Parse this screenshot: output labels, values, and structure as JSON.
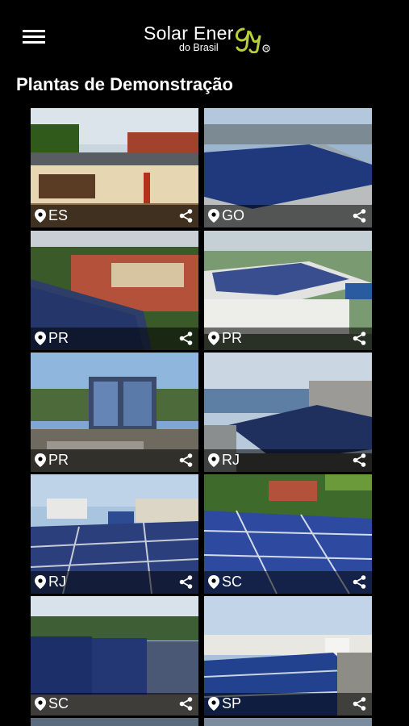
{
  "header": {
    "logo_text_main": "Solar Ener",
    "logo_text_sub": "do Brasil",
    "menu_icon": "hamburger-menu-icon"
  },
  "page": {
    "title": "Plantas de Demonstração"
  },
  "plants": [
    {
      "state": "ES"
    },
    {
      "state": "GO"
    },
    {
      "state": "PR"
    },
    {
      "state": "PR"
    },
    {
      "state": "PR"
    },
    {
      "state": "RJ"
    },
    {
      "state": "RJ"
    },
    {
      "state": "SC"
    },
    {
      "state": "SC"
    },
    {
      "state": "SP"
    }
  ],
  "colors": {
    "background": "#000000",
    "accent_logo": "#b7cf3a",
    "label_overlay": "rgba(0,0,0,0.55)"
  }
}
